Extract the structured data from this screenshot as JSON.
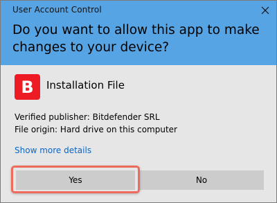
{
  "window": {
    "title": "User Account Control",
    "close_icon": "close-icon",
    "header_color": "#56a4e4"
  },
  "prompt": {
    "question": "Do you want to allow this app to make changes to your device?"
  },
  "app": {
    "icon_letter": "B",
    "icon_color": "#ed1c24",
    "name": "Installation File"
  },
  "details": {
    "publisher": "Verified publisher: Bitdefender SRL",
    "origin": "File origin: Hard drive on this computer",
    "show_more": "Show more details"
  },
  "buttons": {
    "yes": "Yes",
    "no": "No"
  },
  "highlight_color": "#f06a5c"
}
